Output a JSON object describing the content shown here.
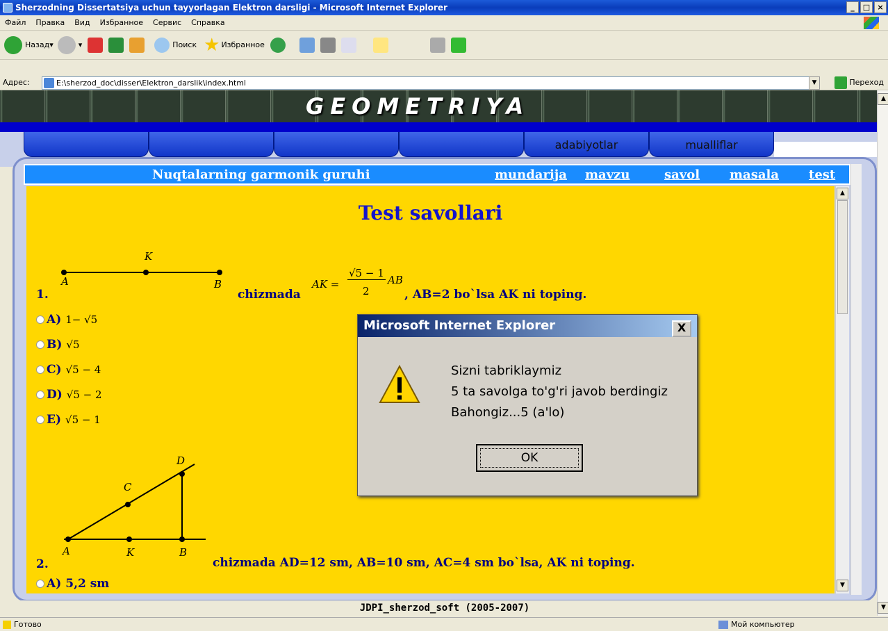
{
  "window": {
    "title": "Sherzodning Dissertatsiya uchun tayyorlagan Elektron darsligi - Microsoft Internet Explorer",
    "min": "_",
    "max": "□",
    "close": "×"
  },
  "menu": [
    "Файл",
    "Правка",
    "Вид",
    "Избранное",
    "Сервис",
    "Справка"
  ],
  "toolbar": {
    "back": "Назад",
    "search": "Поиск",
    "favorites": "Избранное"
  },
  "address": {
    "label": "Адрес:",
    "value": "E:\\sherzod_doc\\disser\\Elektron_darslik\\index.html",
    "go": "Переход"
  },
  "banner": {
    "title": "GEOMETRIYA"
  },
  "tabs": [
    "",
    "",
    "",
    "",
    "adabiyotlar",
    "mualliflar"
  ],
  "nav": {
    "topic": "Nuqtalarning garmonik guruhi",
    "links": [
      "mundarija",
      "mavzu",
      "savol",
      "masala",
      "test"
    ]
  },
  "content": {
    "title": "Test   savollari",
    "q1": {
      "num": "1.",
      "text_a": "chizmada",
      "text_b": ", AB=2 bo`lsa AK ni toping.",
      "labels": [
        "A",
        "K",
        "B"
      ],
      "formula_left": "AK =",
      "formula_num": "√5 − 1",
      "formula_den": "2",
      "formula_right": "AB",
      "options": [
        {
          "key": "A)",
          "val": "1− √5"
        },
        {
          "key": "B)",
          "val": "√5"
        },
        {
          "key": "C)",
          "val": "√5 − 4"
        },
        {
          "key": "D)",
          "val": "√5 − 2"
        },
        {
          "key": "E)",
          "val": "√5 − 1"
        }
      ]
    },
    "q2": {
      "num": "2.",
      "text": "chizmada AD=12 sm, AB=10 sm, AC=4 sm bo`lsa, AK ni toping.",
      "labels": [
        "A",
        "K",
        "B",
        "C",
        "D"
      ],
      "options": [
        {
          "key": "A)",
          "val": "5,2 sm"
        }
      ]
    }
  },
  "footer": "JDPI_sherzod_soft (2005-2007)",
  "status": {
    "left": "Готово",
    "right": "Мой компьютер"
  },
  "dialog": {
    "title": "Microsoft Internet Explorer",
    "lines": [
      "Sizni tabriklaymiz",
      "5 ta savolga to'g'ri javob berdingiz",
      "Bahongiz...5 (a'lo)"
    ],
    "ok": "OK",
    "close": "X"
  }
}
